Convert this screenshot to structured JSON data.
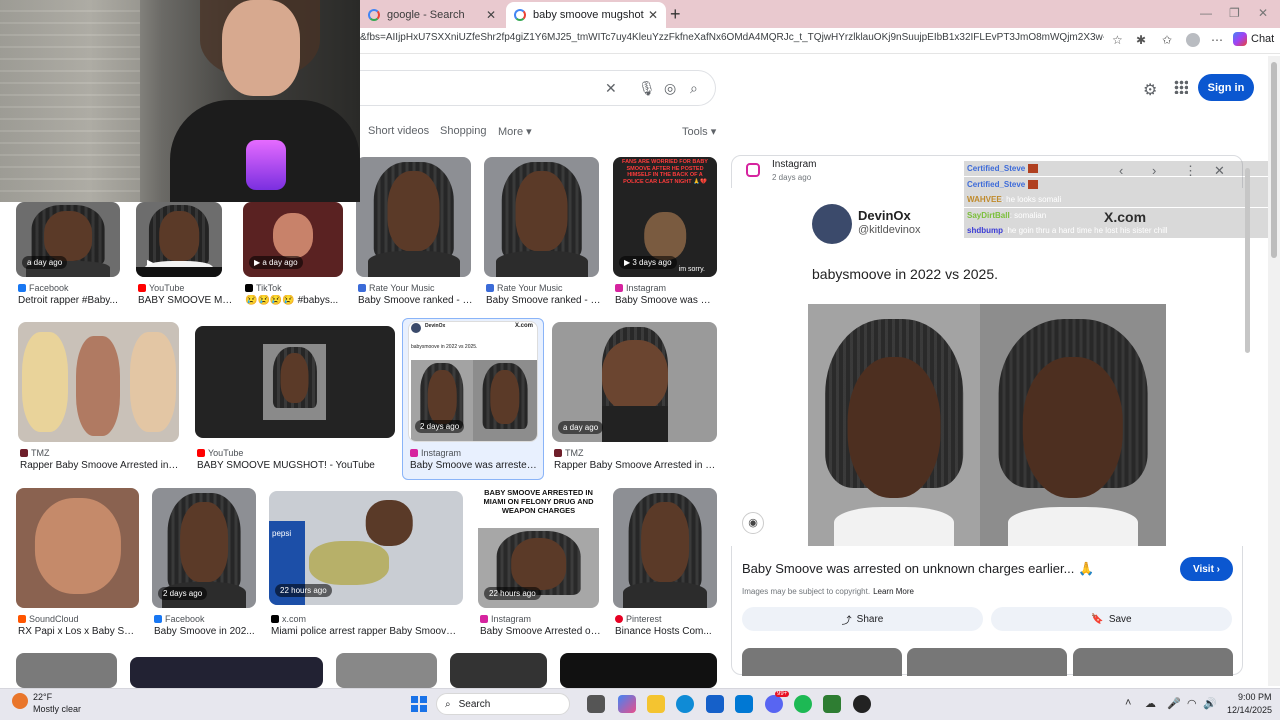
{
  "browser": {
    "tabs": [
      {
        "title": "google - Search"
      },
      {
        "title": "baby smoove mugshot - Google S"
      }
    ],
    "url": "&fbs=AIIjpHxU7SXXniUZfeShr2fp4giZ1Y6MJ25_tmWITc7uy4KleuYzzFkfneXafNx6OMdA4MQRJc_t_TQjwHYrzlklauOKj9nSuujpEIbB1x32IFLEvPT3JmO8mWQjm2X3w-eMKXYxLCPpvXlJ...",
    "chat_label": "Chat"
  },
  "search": {
    "filters": [
      "Short videos",
      "Shopping",
      "More",
      "Tools"
    ],
    "signin_label": "Sign in"
  },
  "results": [
    {
      "badge": "a day ago",
      "source": "Facebook",
      "title": "Detroit rapper #Baby..."
    },
    {
      "badge": "",
      "source": "YouTube",
      "title": "BABY SMOOVE MU..."
    },
    {
      "badge": "a day ago",
      "source": "TikTok",
      "title": "😢😢😢😢 #babys..."
    },
    {
      "badge": "",
      "source": "Rate Your Music",
      "title": "Baby Smoove ranked - R..."
    },
    {
      "badge": "",
      "source": "Rate Your Music",
      "title": "Baby Smoove ranked - R..."
    },
    {
      "badge": "3 days ago",
      "source": "Instagram",
      "title": "Baby Smoove was arr..."
    },
    {
      "badge": "",
      "source": "TMZ",
      "title": "Rapper Baby Smoove Arrested in Mi..."
    },
    {
      "badge": "",
      "source": "YouTube",
      "title": "BABY SMOOVE MUGSHOT! - YouTube"
    },
    {
      "badge": "2 days ago",
      "source": "Instagram",
      "title": "Baby Smoove was arrested ..."
    },
    {
      "badge": "a day ago",
      "source": "TMZ",
      "title": "Rapper Baby Smoove Arrested in Mi..."
    },
    {
      "badge": "",
      "source": "SoundCloud",
      "title": "RX Papi x Los x Baby Smo..."
    },
    {
      "badge": "2 days ago",
      "source": "Facebook",
      "title": "Baby Smoove in 202..."
    },
    {
      "badge": "22 hours ago",
      "source": "x.com",
      "title": "Miami police arrest rapper Baby Smoove ..."
    },
    {
      "badge": "22 hours ago",
      "source": "Instagram",
      "title": "Baby Smoove Arrested on..."
    },
    {
      "badge": "",
      "source": "Pinterest",
      "title": "Binance Hosts Com..."
    }
  ],
  "thumb_text": {
    "fans_worried": "FANS ARE WORRIED FOR BABY SMOOVE AFTER HE POSTED HIMSELF IN THE BACK OF A POLICE CAR LAST NIGHT 🙏💔",
    "im_sorry": "im sorry.",
    "arrested": "BABY SMOOVE ARRESTED IN MIAMI ON FELONY DRUG AND WEAPON CHARGES",
    "devinox": "DevinOx",
    "xcom": "X.com",
    "tweet_small": "babysmoove in 2022 vs 2025.",
    "pepsi": "pepsi"
  },
  "preview": {
    "source": "Instagram",
    "age": "2 days ago",
    "handle_name": "DevinOx",
    "handle_at": "@kitldevinox",
    "xcom": "X.com",
    "tweet": "babysmoove in 2022 vs 2025.",
    "title": "Baby Smoove was arrested on unknown charges earlier... 🙏",
    "visit_label": "Visit ›",
    "copyright": "Images may be subject to copyright.",
    "learn_more": "Learn More",
    "share_label": "Share",
    "save_label": "Save"
  },
  "chat": [
    {
      "user": "Certified_Steve",
      "text": ""
    },
    {
      "user": "Certified_Steve",
      "text": ""
    },
    {
      "user": "WAHVEE",
      "text": ": he looks somali"
    },
    {
      "user": "SayDirtBall",
      "text": ": somalian"
    },
    {
      "user": "shdbump",
      "text": ": he goin thru a hard time he lost his sister chill"
    }
  ],
  "taskbar": {
    "temp": "22°F",
    "condition": "Mostly clear",
    "search_label": "Search",
    "time": "9:00 PM",
    "date": "12/14/2025",
    "notif_badge": "99+"
  },
  "colors": {
    "accent": "#0b57d0",
    "tabbar": "#e9c9cf"
  },
  "icons": [
    "search-icon",
    "mic-icon",
    "lens-icon",
    "clear-icon",
    "settings-icon",
    "apps-icon",
    "share-icon",
    "bookmark-icon",
    "close-icon",
    "chevron-left-icon",
    "chevron-right-icon"
  ]
}
